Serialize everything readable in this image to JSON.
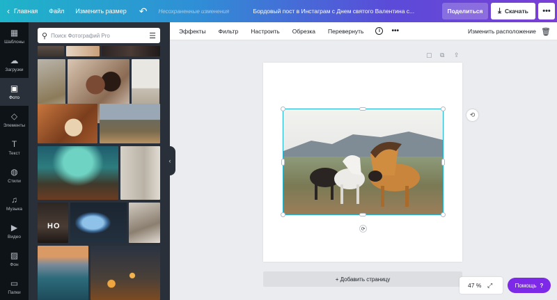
{
  "topbar": {
    "back_label": "Главная",
    "file_label": "Файл",
    "resize_label": "Изменить размер",
    "autosave_text": "Несохраненные изменения",
    "doc_title": "Бордовый пост в Инстаграм с Днем святого Валентина с...",
    "share_label": "Поделиться",
    "download_label": "Скачать"
  },
  "rail": {
    "items": [
      {
        "label": "Шаблоны",
        "icon": "layout-icon"
      },
      {
        "label": "Загрузки",
        "icon": "upload-icon"
      },
      {
        "label": "Фото",
        "icon": "photo-icon"
      },
      {
        "label": "Элементы",
        "icon": "shapes-icon"
      },
      {
        "label": "Текст",
        "icon": "text-icon"
      },
      {
        "label": "Стили",
        "icon": "palette-icon"
      },
      {
        "label": "Музыка",
        "icon": "music-icon"
      },
      {
        "label": "Видео",
        "icon": "video-icon"
      },
      {
        "label": "Фон",
        "icon": "background-icon"
      },
      {
        "label": "Папки",
        "icon": "folder-icon"
      }
    ]
  },
  "panel": {
    "search_placeholder": "Поиск Фотографий Pro",
    "photo_overlay_text": "HO"
  },
  "toolbar": {
    "effects": "Эффекты",
    "filter": "Фильтр",
    "adjust": "Настроить",
    "crop": "Обрезка",
    "flip": "Перевернуть",
    "info": "i",
    "position": "Изменить расположение"
  },
  "canvas": {
    "add_page_label": "+ Добавить страницу",
    "zoom_value": "47 %",
    "help_label": "Помощь",
    "help_q": "?"
  },
  "colors": {
    "accent": "#7d2ae8",
    "selection": "#1fb4d1",
    "panel_bg": "#293039",
    "rail_bg": "#0e1318"
  }
}
